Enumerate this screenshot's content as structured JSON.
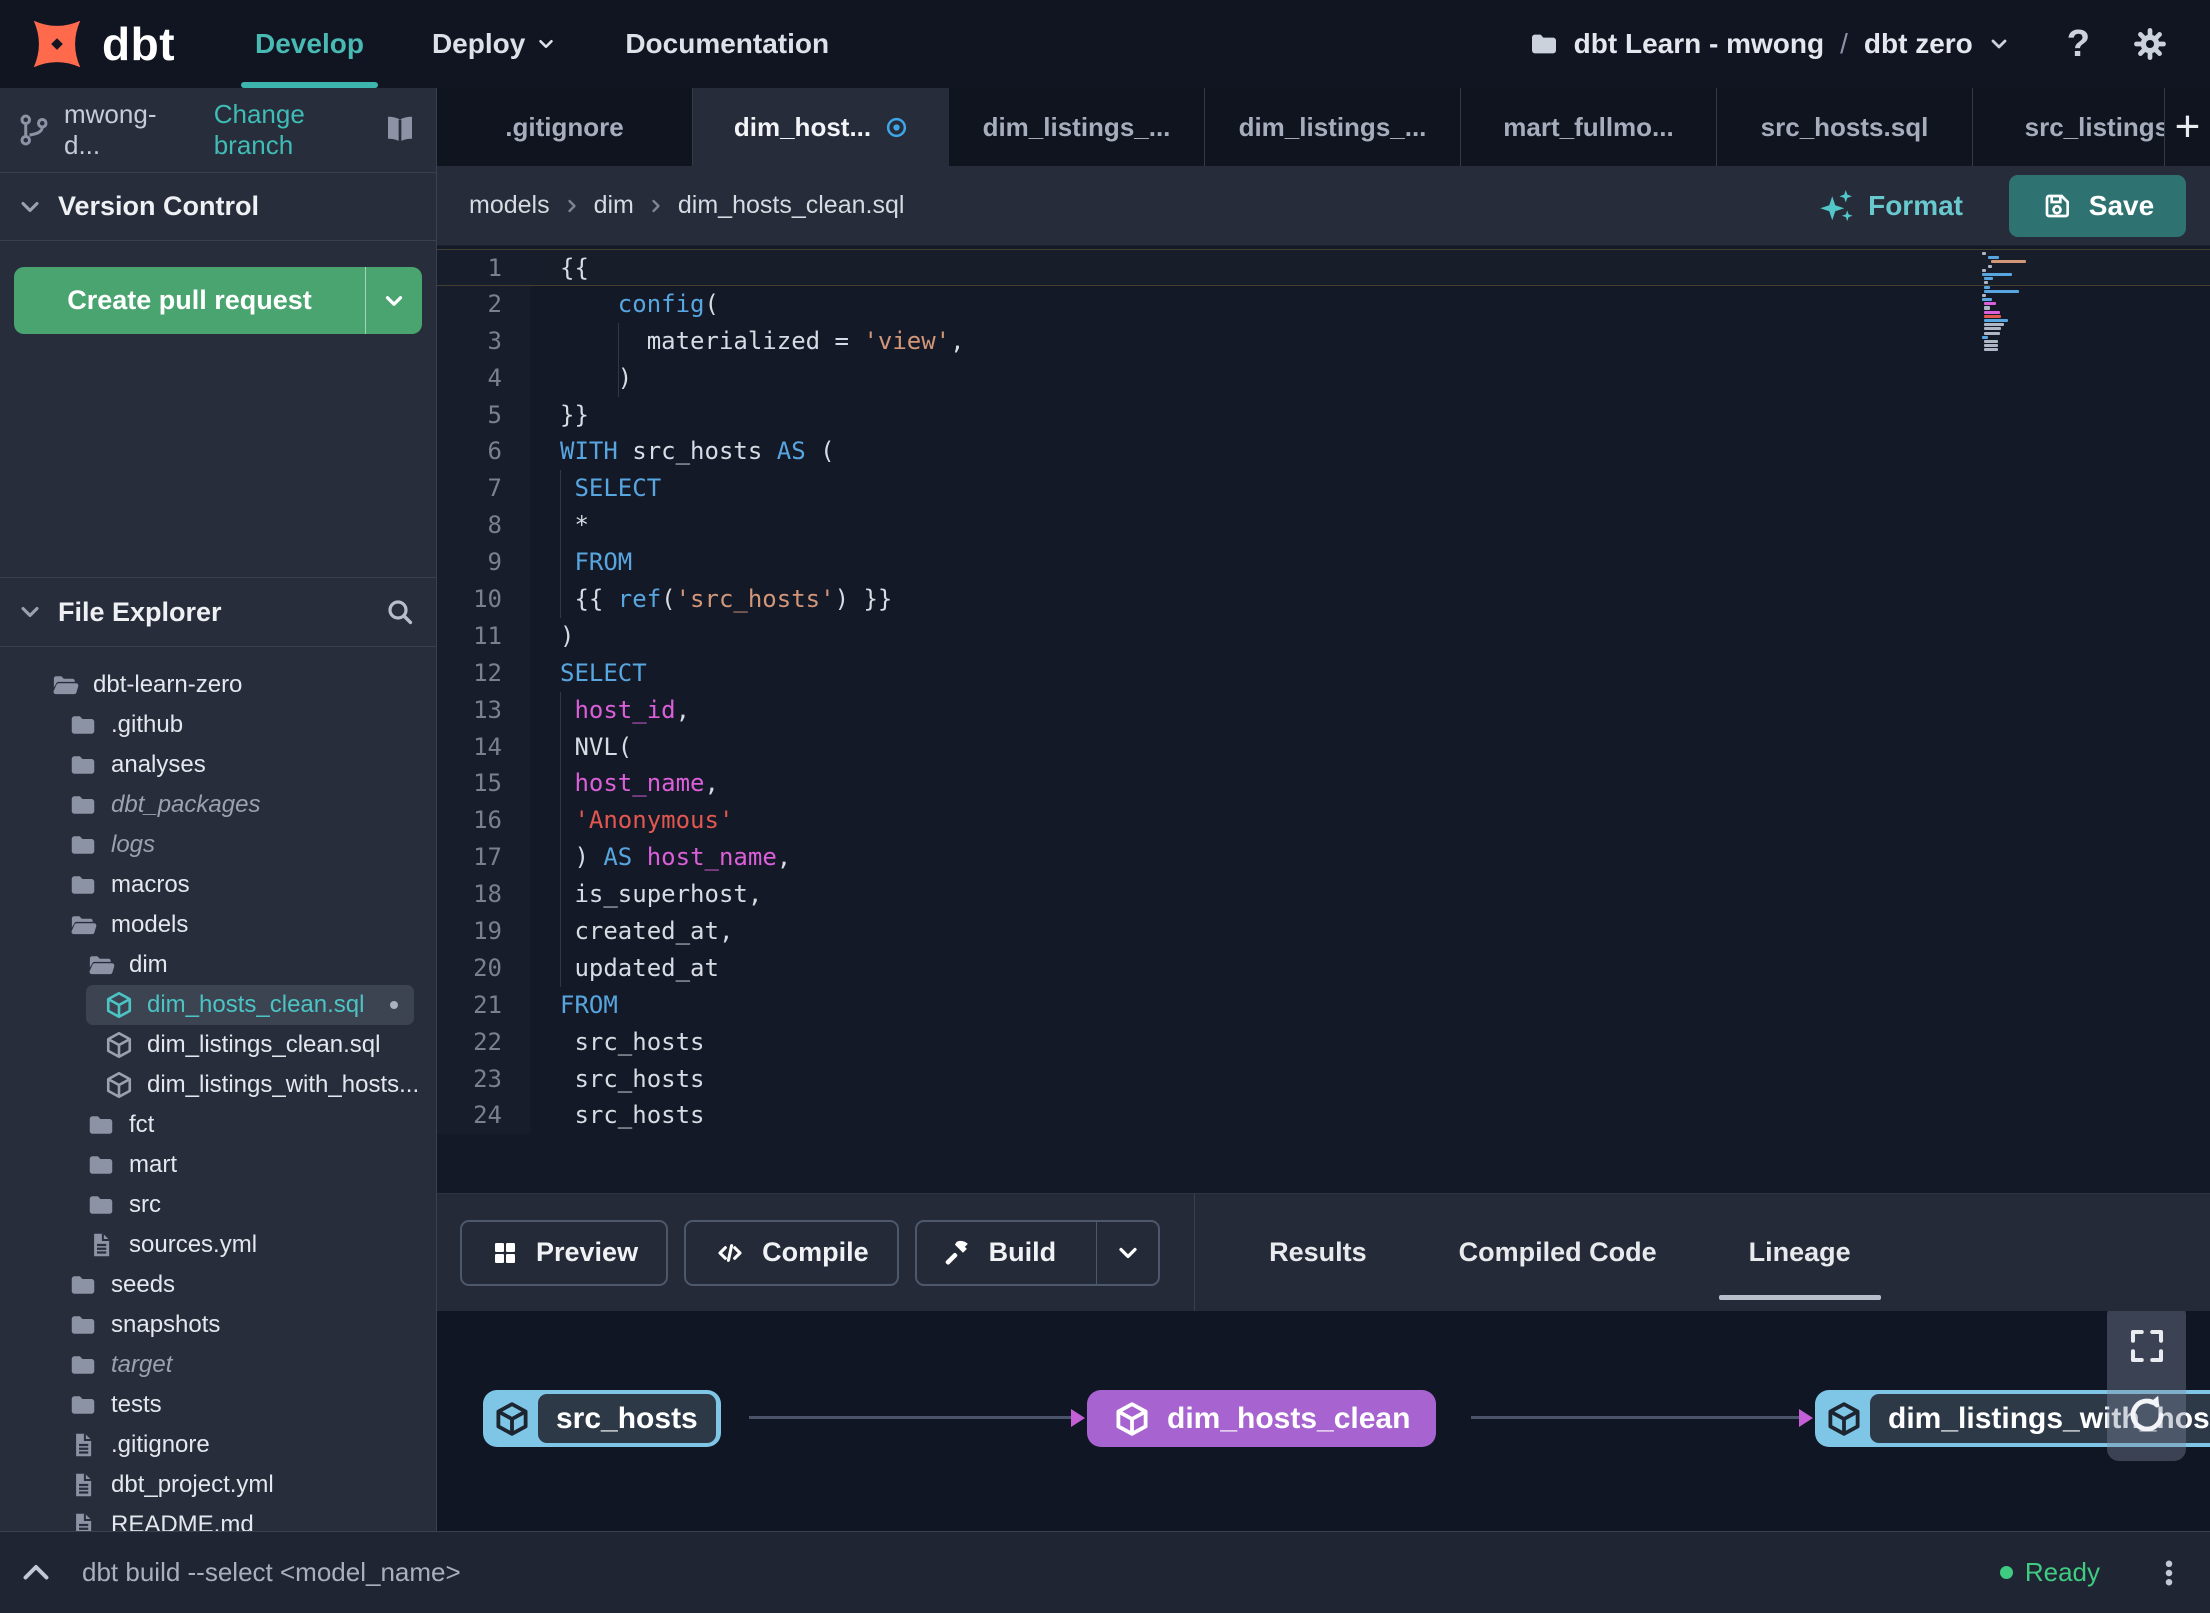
{
  "navbar": {
    "brand": "dbt",
    "develop": "Develop",
    "deploy": "Deploy",
    "documentation": "Documentation",
    "account": "dbt Learn - mwong",
    "separator": "/",
    "environment": "dbt zero",
    "help_label": "?"
  },
  "sidebar": {
    "branch_name": "mwong-d...",
    "change_branch": "Change branch",
    "version_control": "Version Control",
    "create_pull_request": "Create pull request",
    "file_explorer": "File Explorer",
    "tree": [
      {
        "label": "dbt-learn-zero",
        "level": 0,
        "type": "folder-open"
      },
      {
        "label": ".github",
        "level": 1,
        "type": "folder"
      },
      {
        "label": "analyses",
        "level": 1,
        "type": "folder"
      },
      {
        "label": "dbt_packages",
        "level": 1,
        "type": "folder",
        "italic": true
      },
      {
        "label": "logs",
        "level": 1,
        "type": "folder",
        "italic": true
      },
      {
        "label": "macros",
        "level": 1,
        "type": "folder"
      },
      {
        "label": "models",
        "level": 1,
        "type": "folder-open"
      },
      {
        "label": "dim",
        "level": 2,
        "type": "folder-open"
      },
      {
        "label": "dim_hosts_clean.sql",
        "level": 3,
        "type": "model",
        "selected": true,
        "modified": true
      },
      {
        "label": "dim_listings_clean.sql",
        "level": 3,
        "type": "model"
      },
      {
        "label": "dim_listings_with_hosts...",
        "level": 3,
        "type": "model"
      },
      {
        "label": "fct",
        "level": 2,
        "type": "folder"
      },
      {
        "label": "mart",
        "level": 2,
        "type": "folder"
      },
      {
        "label": "src",
        "level": 2,
        "type": "folder"
      },
      {
        "label": "sources.yml",
        "level": 2,
        "type": "file"
      },
      {
        "label": "seeds",
        "level": 1,
        "type": "folder"
      },
      {
        "label": "snapshots",
        "level": 1,
        "type": "folder"
      },
      {
        "label": "target",
        "level": 1,
        "type": "folder",
        "italic": true
      },
      {
        "label": "tests",
        "level": 1,
        "type": "folder"
      },
      {
        "label": ".gitignore",
        "level": 1,
        "type": "file"
      },
      {
        "label": "dbt_project.yml",
        "level": 1,
        "type": "file"
      },
      {
        "label": "README.md",
        "level": 1,
        "type": "file"
      }
    ]
  },
  "tabs": {
    "items": [
      {
        "label": ".gitignore"
      },
      {
        "label": "dim_host...",
        "active": true,
        "modified": true
      },
      {
        "label": "dim_listings_..."
      },
      {
        "label": "dim_listings_..."
      },
      {
        "label": "mart_fullmo..."
      },
      {
        "label": "src_hosts.sql"
      },
      {
        "label": "src_listings."
      }
    ],
    "new_tab": "+"
  },
  "editor": {
    "breadcrumb": [
      "models",
      "dim",
      "dim_hosts_clean.sql"
    ],
    "format": "Format",
    "save": "Save",
    "lines": [
      {
        "n": 1,
        "t": [
          [
            "{{",
            "p"
          ]
        ]
      },
      {
        "n": 2,
        "t": [
          [
            "    ",
            "p"
          ],
          [
            "config",
            "k"
          ],
          [
            "(",
            "p"
          ]
        ]
      },
      {
        "n": 3,
        "g": [
          4
        ],
        "t": [
          [
            "      materialized = ",
            "p"
          ],
          [
            "'view'",
            "s"
          ],
          [
            ",",
            "p"
          ]
        ]
      },
      {
        "n": 4,
        "g": [
          4
        ],
        "t": [
          [
            "    )",
            "p"
          ]
        ]
      },
      {
        "n": 5,
        "t": [
          [
            "}}",
            "p"
          ]
        ]
      },
      {
        "n": 6,
        "t": [
          [
            "WITH",
            "k"
          ],
          [
            " src_hosts ",
            "p"
          ],
          [
            "AS",
            "k"
          ],
          [
            " (",
            "p"
          ]
        ]
      },
      {
        "n": 7,
        "g": [
          0
        ],
        "t": [
          [
            " ",
            "p"
          ],
          [
            "SELECT",
            "k"
          ]
        ]
      },
      {
        "n": 8,
        "g": [
          0
        ],
        "t": [
          [
            " *",
            "p"
          ]
        ]
      },
      {
        "n": 9,
        "g": [
          0
        ],
        "t": [
          [
            " ",
            "p"
          ],
          [
            "FROM",
            "k"
          ]
        ]
      },
      {
        "n": 10,
        "g": [
          0
        ],
        "t": [
          [
            " {{ ",
            "p"
          ],
          [
            "ref",
            "k"
          ],
          [
            "(",
            "p"
          ],
          [
            "'src_hosts'",
            "s"
          ],
          [
            ") }}",
            "p"
          ]
        ]
      },
      {
        "n": 11,
        "t": [
          [
            ")",
            "p"
          ]
        ]
      },
      {
        "n": 12,
        "t": [
          [
            "SELECT",
            "k"
          ]
        ]
      },
      {
        "n": 13,
        "g": [
          0
        ],
        "t": [
          [
            " ",
            "p"
          ],
          [
            "host_id",
            "m"
          ],
          [
            ",",
            "p"
          ]
        ]
      },
      {
        "n": 14,
        "g": [
          0
        ],
        "t": [
          [
            " NVL(",
            "p"
          ]
        ]
      },
      {
        "n": 15,
        "g": [
          0
        ],
        "t": [
          [
            " ",
            "p"
          ],
          [
            "host_name",
            "m"
          ],
          [
            ",",
            "p"
          ]
        ]
      },
      {
        "n": 16,
        "g": [
          0
        ],
        "t": [
          [
            " ",
            "p"
          ],
          [
            "'Anonymous'",
            "r"
          ]
        ]
      },
      {
        "n": 17,
        "g": [
          0
        ],
        "t": [
          [
            " ) ",
            "p"
          ],
          [
            "AS",
            "k"
          ],
          [
            " ",
            "p"
          ],
          [
            "host_name",
            "m"
          ],
          [
            ",",
            "p"
          ]
        ]
      },
      {
        "n": 18,
        "g": [
          0
        ],
        "t": [
          [
            " is_superhost,",
            "p"
          ]
        ]
      },
      {
        "n": 19,
        "g": [
          0
        ],
        "t": [
          [
            " created_at,",
            "p"
          ]
        ]
      },
      {
        "n": 20,
        "g": [
          0
        ],
        "t": [
          [
            " updated_at",
            "p"
          ]
        ]
      },
      {
        "n": 21,
        "t": [
          [
            "FROM",
            "k"
          ]
        ]
      },
      {
        "n": 22,
        "t": [
          [
            " src_hosts",
            "p"
          ]
        ]
      },
      {
        "n": 23,
        "t": [
          [
            " src_hosts",
            "p"
          ]
        ]
      },
      {
        "n": 24,
        "t": [
          [
            " src_hosts",
            "p"
          ]
        ]
      }
    ]
  },
  "panel": {
    "preview": "Preview",
    "compile": "Compile",
    "build": "Build",
    "tabs": [
      {
        "label": "Results"
      },
      {
        "label": "Compiled Code"
      },
      {
        "label": "Lineage",
        "active": true
      }
    ]
  },
  "lineage": {
    "nodes": [
      {
        "label": "src_hosts",
        "kind": "source"
      },
      {
        "label": "dim_hosts_clean",
        "kind": "model"
      },
      {
        "label": "dim_listings_with_hosts",
        "kind": "source"
      }
    ]
  },
  "statusbar": {
    "command": "dbt build --select <model_name>",
    "status": "Ready"
  },
  "colors": {
    "accent_teal": "#46b8b2",
    "pr_button_green": "#4aa470",
    "save_button_teal": "#2e7271",
    "modified_dot_blue": "#3da5e8",
    "ready_green": "#3fcb82",
    "node_source_blue": "#7fc5e6",
    "node_model_purple": "#a763cf",
    "edge_arrow_purple": "#c45fd8",
    "code_keyword": "#58a6e0",
    "code_string": "#d29679",
    "code_string_alt": "#e25750",
    "code_identifier": "#da5fd8",
    "logo_orange": "#ff6a4d"
  }
}
